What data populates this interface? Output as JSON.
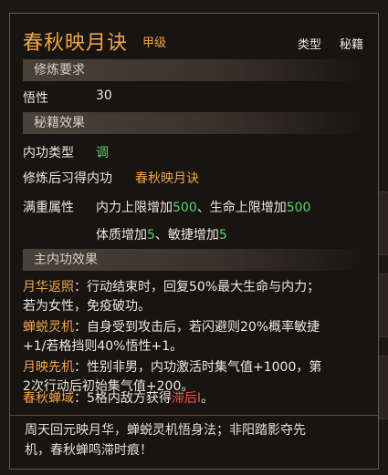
{
  "title": "春秋映月诀",
  "grade": "甲级",
  "type_label": "类型",
  "type_value": "秘籍",
  "req_section": "修炼要求",
  "req": {
    "label": "悟性",
    "value": "30"
  },
  "book_section": "秘籍效果",
  "internal_type": {
    "label": "内功类型",
    "value": "调"
  },
  "learned": {
    "label": "修炼后习得内功",
    "value": "春秋映月诀"
  },
  "full_attr": {
    "label": "满重属性",
    "line1_a": "内力上限增加",
    "line1_a_val": "500",
    "line1_sep": "、生命上限增加",
    "line1_b_val": "500",
    "line2_a": "体质增加",
    "line2_a_val": "5",
    "line2_sep": "、敏捷增加",
    "line2_b_val": "5"
  },
  "main_section": "主内功效果",
  "skills": [
    {
      "name": "月华返照",
      "text": "：行动结束时，回复50%最大生命与内力；",
      "text2": "若为女性，免疫破功。"
    },
    {
      "name": "蝉蜕灵机",
      "text": "：自身受到攻击后，若闪避则20%概率敏捷",
      "text2": "+1/若格挡则40%悟性+1。"
    },
    {
      "name": "月映先机",
      "text": "：性别非男，内功激活时集气值+1000，第",
      "text2": "2次行动后初始集气值+200。"
    },
    {
      "name": "春秋蝉域",
      "text": "：5格内敌方获得",
      "status": "滞后Ⅰ",
      "tail": "。"
    }
  ],
  "footer_line1": "周天回元映月华，蝉蜕灵机悟身法；非阳踏影夺先",
  "footer_line2": "机，春秋蝉鸣滞时痕！",
  "colors": {
    "accent": "#f2a54a",
    "value_green": "#5fd36a",
    "status_red": "#e65a4a"
  }
}
